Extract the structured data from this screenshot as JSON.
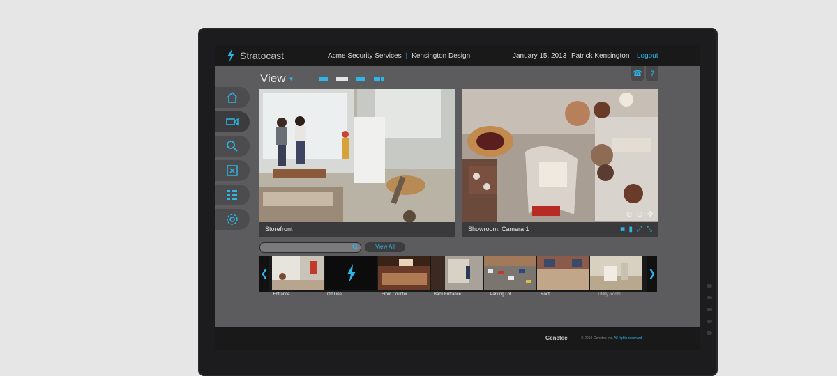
{
  "app": {
    "name": "Stratocast"
  },
  "header": {
    "company": "Acme Security Services",
    "site": "Kensington Design",
    "date": "January 15, 2013",
    "user": "Patrick Kensington",
    "logout": "Logout"
  },
  "view": {
    "label": "View"
  },
  "help": {
    "phone": "☎",
    "question": "?"
  },
  "cameras": [
    {
      "name": "Storefront"
    },
    {
      "name": "Showroom: Camera 1"
    }
  ],
  "search": {
    "placeholder": "",
    "view_all": "View All"
  },
  "thumbnails": [
    {
      "label": "Entrance"
    },
    {
      "label": "Off Line"
    },
    {
      "label": "Front Counter"
    },
    {
      "label": "Back Entrance"
    },
    {
      "label": "Parking Lot"
    },
    {
      "label": "Roof"
    },
    {
      "label": "Utility Room"
    }
  ],
  "footer": {
    "brand": "Genetec",
    "copyright": "© 2013 Genetec Inc.",
    "rights": "All rights reserved"
  },
  "colors": {
    "accent": "#2bb7e8"
  }
}
